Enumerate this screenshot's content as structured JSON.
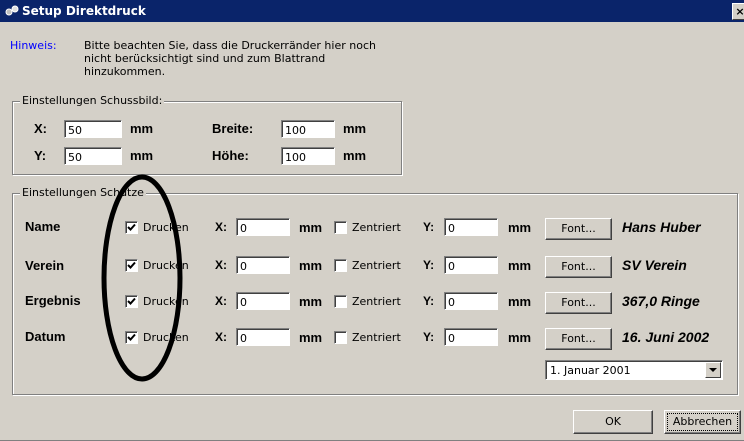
{
  "window": {
    "title": "Setup Direktdruck",
    "close_label": "×"
  },
  "hint": {
    "label": "Hinweis:",
    "lines": [
      "Bitte beachten Sie, dass die Druckerränder hier noch",
      "nicht berücksichtigt sind und zum Blattrand",
      "hinzukommen."
    ]
  },
  "schussbild": {
    "legend": "Einstellungen Schussbild:",
    "x_label": "X:",
    "x_value": "50",
    "x_unit": "mm",
    "y_label": "Y:",
    "y_value": "50",
    "y_unit": "mm",
    "breite_label": "Breite:",
    "breite_value": "100",
    "breite_unit": "mm",
    "hoehe_label": "Höhe:",
    "hoehe_value": "100",
    "hoehe_unit": "mm"
  },
  "schuetze": {
    "legend": "Einstellungen Schütze",
    "check_label": "Drucken",
    "x_label": "X:",
    "y_label": "Y:",
    "unit": "mm",
    "zentriert_label": "Zentriert",
    "font_button": "Font...",
    "rows": [
      {
        "label": "Name",
        "drucken": true,
        "x": "0",
        "zentriert": false,
        "y": "0",
        "preview": "Hans Huber"
      },
      {
        "label": "Verein",
        "drucken": true,
        "x": "0",
        "zentriert": false,
        "y": "0",
        "preview": "SV Verein"
      },
      {
        "label": "Ergebnis",
        "drucken": true,
        "x": "0",
        "zentriert": false,
        "y": "0",
        "preview": "367,0 Ringe"
      },
      {
        "label": "Datum",
        "drucken": true,
        "x": "0",
        "zentriert": false,
        "y": "0",
        "preview": "16. Juni 2002"
      }
    ],
    "date_format": "1. Januar 2001"
  },
  "buttons": {
    "ok": "OK",
    "cancel": "Abbrechen"
  },
  "colors": {
    "titlebar": "#0a246a",
    "face": "#d4d0c8",
    "hint_label": "#0000ff",
    "annotation": "#000000"
  }
}
